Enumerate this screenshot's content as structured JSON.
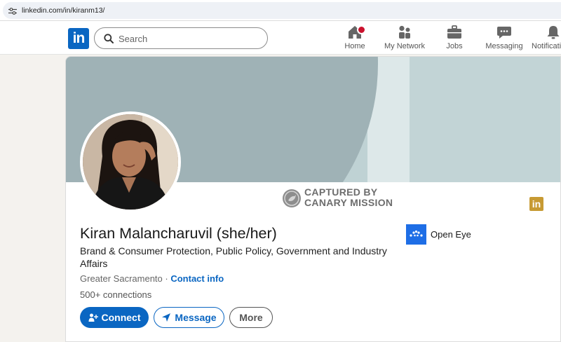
{
  "browser": {
    "url": "linkedin.com/in/kiranm13/"
  },
  "nav": {
    "logo_text": "in",
    "search_placeholder": "Search",
    "items": [
      {
        "label": "Home",
        "icon": "home-icon"
      },
      {
        "label": "My Network",
        "icon": "network-icon"
      },
      {
        "label": "Jobs",
        "icon": "briefcase-icon"
      },
      {
        "label": "Messaging",
        "icon": "chat-icon"
      },
      {
        "label": "Notifications",
        "icon": "bell-icon"
      }
    ]
  },
  "profile": {
    "name": "Kiran Malancharuvil (she/her)",
    "headline": "Brand & Consumer Protection, Public Policy, Government and Industry Affairs",
    "location": "Greater Sacramento",
    "separator": " · ",
    "contact_info": "Contact info",
    "connections": "500+ connections",
    "organization": "Open Eye"
  },
  "watermark": {
    "line1": "CAPTURED BY",
    "line2": "CANARY MISSION"
  },
  "actions": {
    "connect": "Connect",
    "message": "Message",
    "more": "More"
  },
  "colors": {
    "brand": "#0a66c2",
    "notification_badge": "#cb112d",
    "watermark_badge": "#c79a33",
    "org_logo": "#1e6ee6"
  }
}
